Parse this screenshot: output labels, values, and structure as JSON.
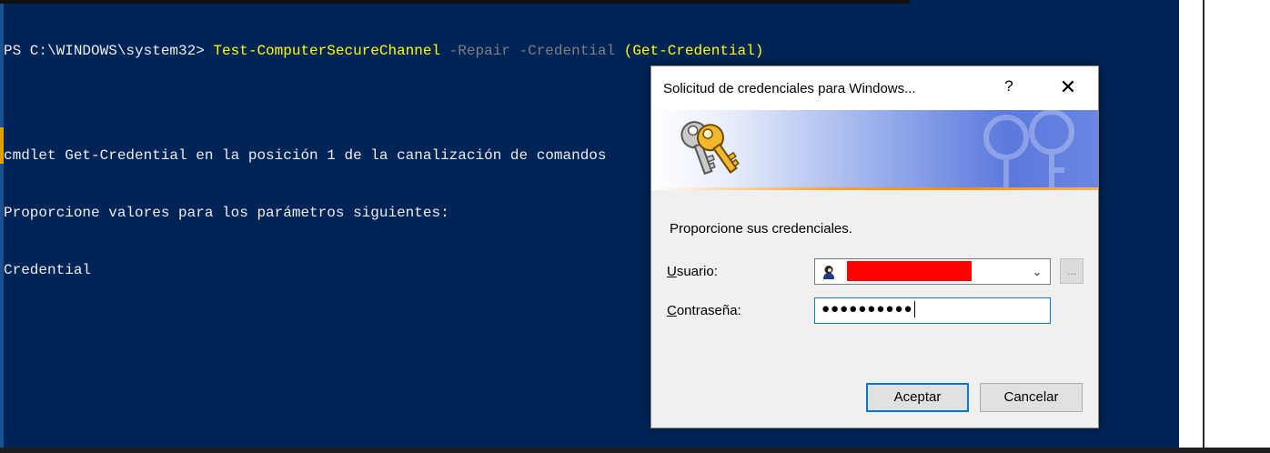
{
  "console": {
    "prompt": "PS C:\\WINDOWS\\system32> ",
    "command": "Test-ComputerSecureChannel",
    "param1": " -Repair -Credential ",
    "subcommand": "(Get-Credential)",
    "line2": "cmdlet Get-Credential en la posición 1 de la canalización de comandos",
    "line3": "Proporcione valores para los parámetros siguientes:",
    "line4": "Credential"
  },
  "dialog": {
    "title": "Solicitud de credenciales para Windows...",
    "help_label": "?",
    "close_label": "✕",
    "prompt": "Proporcione sus credenciales.",
    "user_label_accel": "U",
    "user_label_rest": "suario:",
    "password_label_accel": "C",
    "password_label_rest": "ontraseña:",
    "password_masked": "●●●●●●●●●●",
    "browse_label": "...",
    "ok_label": "Aceptar",
    "cancel_label": "Cancelar"
  },
  "colors": {
    "console_bg": "#012456",
    "command_yellow": "#ffff00",
    "param_gray": "#7f7f7f",
    "accent_blue": "#0078d7"
  },
  "icons": [
    "keys-icon",
    "key-watermark-icon",
    "user-avatar-icon",
    "chevron-down-icon",
    "close-icon",
    "help-icon"
  ]
}
